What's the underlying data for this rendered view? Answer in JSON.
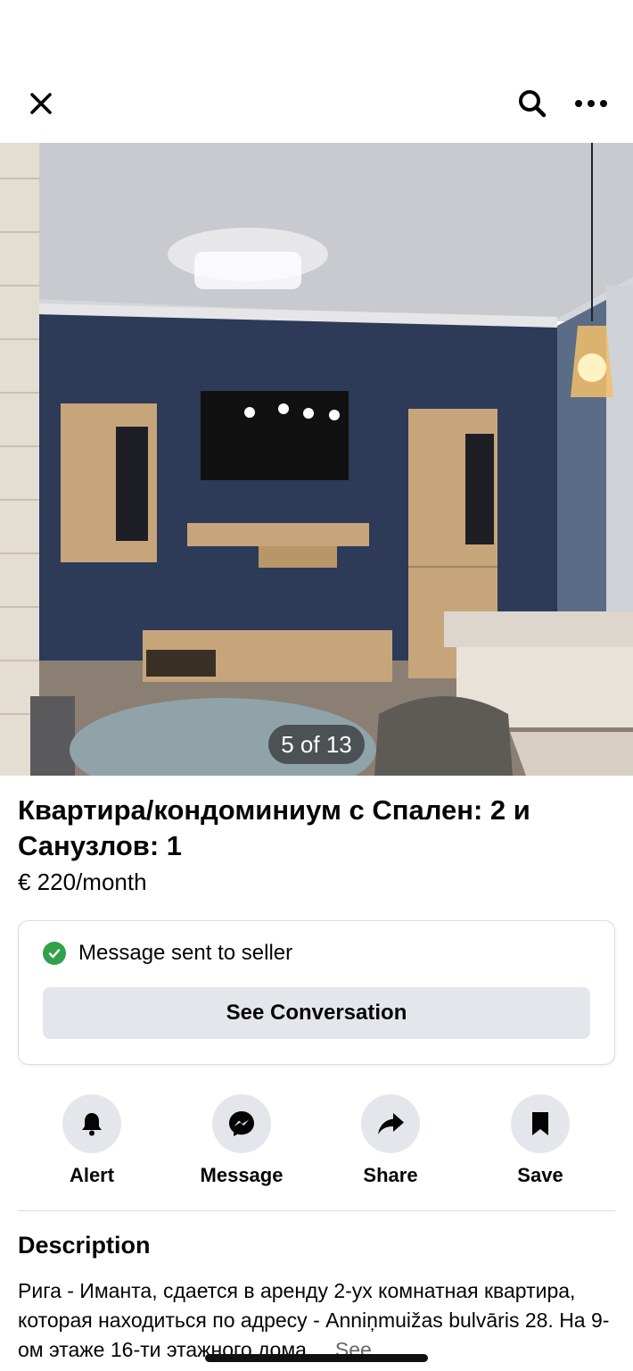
{
  "header": {
    "close_icon": "close-icon",
    "search_icon": "search-icon",
    "more_icon": "more-icon"
  },
  "photo": {
    "counter": "5 of 13"
  },
  "listing": {
    "title": "Квартира/кондоминиум с Спален: 2 и Санузлов: 1",
    "price": "€ 220/month"
  },
  "status": {
    "message": "Message sent to seller",
    "button": "See Conversation",
    "color": "#31a24c"
  },
  "actions": [
    {
      "label": "Alert",
      "icon": "bell-icon"
    },
    {
      "label": "Message",
      "icon": "messenger-icon"
    },
    {
      "label": "Share",
      "icon": "share-icon"
    },
    {
      "label": "Save",
      "icon": "bookmark-icon"
    }
  ],
  "description": {
    "heading": "Description",
    "text": "Рига - Иманта, сдается в аренду 2-ух комнатная квартира, которая находиться по адресу - Anniņmuižas bulvāris 28. На 9-ом этаже 16-ти этажного дома....",
    "see_more": "See"
  }
}
